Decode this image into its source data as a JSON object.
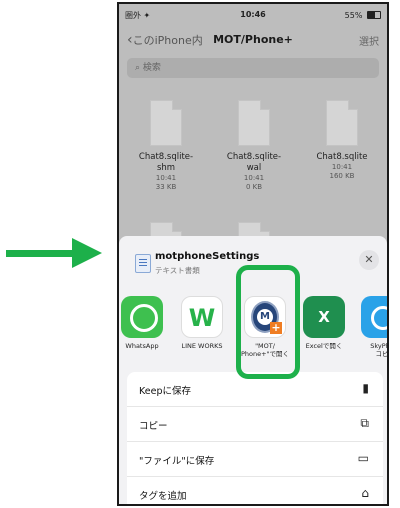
{
  "status": {
    "carrier": "圏外 ✦",
    "time": "10:46",
    "battery": "55%"
  },
  "navbar": {
    "back_label": "このiPhone内",
    "title": "MOT/Phone+",
    "select_label": "選択"
  },
  "search": {
    "placeholder": "検索"
  },
  "files": [
    {
      "name": "Chat8.sqlite-\nshm",
      "time": "10:41",
      "size": "33 KB"
    },
    {
      "name": "Chat8.sqlite-\nwal",
      "time": "10:41",
      "size": "0 KB"
    },
    {
      "name": "Chat8.sqlite",
      "time": "10:41",
      "size": "160 KB"
    }
  ],
  "sheet": {
    "title": "motphoneSettings",
    "subtitle": "テキスト書類",
    "close_icon": "close-icon"
  },
  "apps": [
    {
      "label": "WhatsApp",
      "icon": "whatsapp-icon"
    },
    {
      "label": "LINE WORKS",
      "icon": "line-works-icon",
      "glyph": "W"
    },
    {
      "label": "\"MOT/\nPhone+\"で開く",
      "icon": "mot-phone-icon",
      "glyph": "M"
    },
    {
      "label": "Excelで開く",
      "icon": "excel-icon",
      "glyph": "X"
    },
    {
      "label": "SkyPho\nコピ",
      "icon": "skype-icon"
    }
  ],
  "actions": [
    {
      "label": "Keepに保存",
      "icon": "bookmark-icon"
    },
    {
      "label": "コピー",
      "icon": "copy-icon"
    },
    {
      "label": "\"ファイル\"に保存",
      "icon": "folder-icon"
    },
    {
      "label": "タグを追加",
      "icon": "tag-icon"
    }
  ],
  "colors": {
    "highlight": "#1db04a",
    "arrow": "#1db04a"
  }
}
